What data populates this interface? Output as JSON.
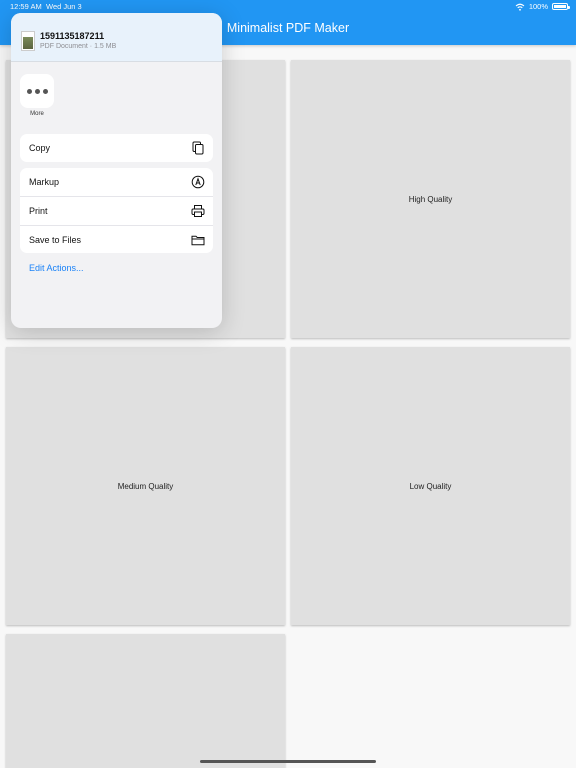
{
  "status_bar": {
    "time": "12:59 AM",
    "date": "Wed Jun 3",
    "battery_text": "100%",
    "battery_level": 1.0
  },
  "app": {
    "title": "Minimalist PDF Maker",
    "accent_color": "#2196f3"
  },
  "grid": {
    "cards": [
      {
        "label": ""
      },
      {
        "label": "High Quality"
      },
      {
        "label": "Medium Quality"
      },
      {
        "label": "Low Quality"
      },
      {
        "label": ""
      }
    ]
  },
  "share_sheet": {
    "file_name": "1591135187211",
    "file_meta": "PDF Document · 1.5 MB",
    "more_label": "More",
    "copy_label": "Copy",
    "actions": [
      {
        "label": "Markup",
        "icon": "markup-icon"
      },
      {
        "label": "Print",
        "icon": "printer-icon"
      },
      {
        "label": "Save to Files",
        "icon": "folder-icon"
      }
    ],
    "edit_actions_label": "Edit Actions...",
    "link_color": "#1a82f7"
  }
}
